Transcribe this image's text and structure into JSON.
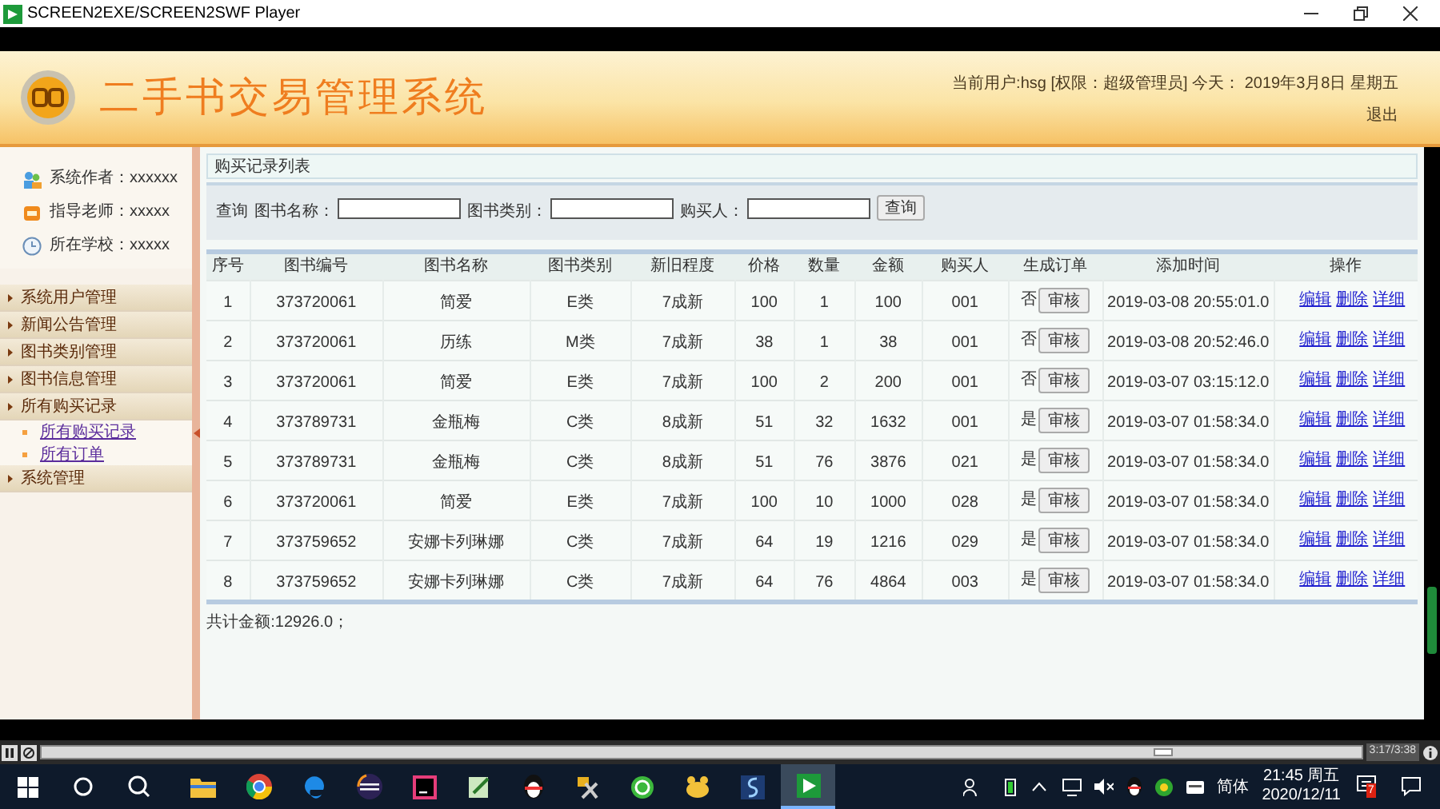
{
  "window": {
    "title": "SCREEN2EXE/SCREEN2SWF Player"
  },
  "header": {
    "title": "二手书交易管理系统",
    "user_info": "当前用户:hsg [权限：超级管理员] 今天： 2019年3月8日 星期五",
    "logout": "退出"
  },
  "sidebar": {
    "info": [
      {
        "kind": "author",
        "text": "系统作者：xxxxxx"
      },
      {
        "kind": "teacher",
        "text": "指导老师：xxxxx"
      },
      {
        "kind": "school",
        "text": "所在学校：xxxxx"
      }
    ],
    "menu": [
      {
        "label": "系统用户管理"
      },
      {
        "label": "新闻公告管理"
      },
      {
        "label": "图书类别管理"
      },
      {
        "label": "图书信息管理"
      },
      {
        "label": "所有购买记录",
        "children": [
          {
            "label": "所有购买记录"
          },
          {
            "label": "所有订单"
          }
        ]
      },
      {
        "label": "系统管理"
      }
    ]
  },
  "panel": {
    "title": "购买记录列表",
    "search": {
      "label": "查询",
      "fields": [
        {
          "label": "图书名称："
        },
        {
          "label": "图书类别："
        },
        {
          "label": "购买人："
        }
      ],
      "button": "查询"
    },
    "table": {
      "columns": [
        "序号",
        "图书编号",
        "图书名称",
        "图书类别",
        "新旧程度",
        "价格",
        "数量",
        "金额",
        "购买人",
        "生成订单",
        "添加时间",
        "操作"
      ],
      "rows": [
        {
          "cells": [
            "1",
            "373720061",
            "简爱",
            "E类",
            "7成新",
            "100",
            "1",
            "100",
            "001"
          ],
          "ordered": "否",
          "review_button": "审核",
          "added": "2019-03-08 20:55:01.0",
          "actions": [
            "编辑",
            "删除",
            "详细"
          ]
        },
        {
          "cells": [
            "2",
            "373720061",
            "历练",
            "M类",
            "7成新",
            "38",
            "1",
            "38",
            "001"
          ],
          "ordered": "否",
          "review_button": "审核",
          "added": "2019-03-08 20:52:46.0",
          "actions": [
            "编辑",
            "删除",
            "详细"
          ]
        },
        {
          "cells": [
            "3",
            "373720061",
            "简爱",
            "E类",
            "7成新",
            "100",
            "2",
            "200",
            "001"
          ],
          "ordered": "否",
          "review_button": "审核",
          "added": "2019-03-07 03:15:12.0",
          "actions": [
            "编辑",
            "删除",
            "详细"
          ]
        },
        {
          "cells": [
            "4",
            "373789731",
            "金瓶梅",
            "C类",
            "8成新",
            "51",
            "32",
            "1632",
            "001"
          ],
          "ordered": "是",
          "review_button": "审核",
          "added": "2019-03-07 01:58:34.0",
          "actions": [
            "编辑",
            "删除",
            "详细"
          ]
        },
        {
          "cells": [
            "5",
            "373789731",
            "金瓶梅",
            "C类",
            "8成新",
            "51",
            "76",
            "3876",
            "021"
          ],
          "ordered": "是",
          "review_button": "审核",
          "added": "2019-03-07 01:58:34.0",
          "actions": [
            "编辑",
            "删除",
            "详细"
          ]
        },
        {
          "cells": [
            "6",
            "373720061",
            "简爱",
            "E类",
            "7成新",
            "100",
            "10",
            "1000",
            "028"
          ],
          "ordered": "是",
          "review_button": "审核",
          "added": "2019-03-07 01:58:34.0",
          "actions": [
            "编辑",
            "删除",
            "详细"
          ]
        },
        {
          "cells": [
            "7",
            "373759652",
            "安娜卡列琳娜",
            "C类",
            "7成新",
            "64",
            "19",
            "1216",
            "029"
          ],
          "ordered": "是",
          "review_button": "审核",
          "added": "2019-03-07 01:58:34.0",
          "actions": [
            "编辑",
            "删除",
            "详细"
          ]
        },
        {
          "cells": [
            "8",
            "373759652",
            "安娜卡列琳娜",
            "C类",
            "7成新",
            "64",
            "76",
            "4864",
            "003"
          ],
          "ordered": "是",
          "review_button": "审核",
          "added": "2019-03-07 01:58:34.0",
          "actions": [
            "编辑",
            "删除",
            "详细"
          ]
        }
      ]
    },
    "total": "共计金额:12926.0；"
  },
  "player": {
    "level": 0.85,
    "time": "3:17/3:38"
  },
  "taskbar": {
    "ime": "简体",
    "time": "21:45 周五",
    "date": "2020/12/11",
    "notification_count": "7"
  }
}
